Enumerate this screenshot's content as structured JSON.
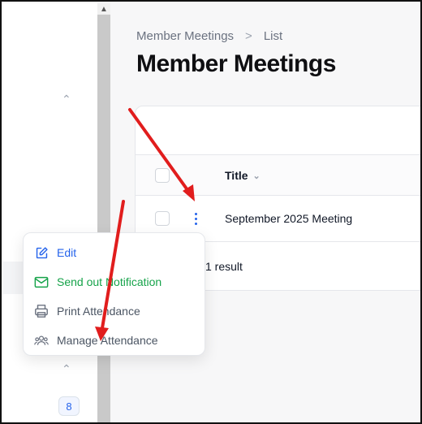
{
  "breadcrumb": {
    "parent": "Member Meetings",
    "separator": ">",
    "current": "List"
  },
  "page_title": "Member Meetings",
  "table": {
    "columns": [
      {
        "label": "Title",
        "sortable": true
      }
    ],
    "rows": [
      {
        "title": "September 2025 Meeting"
      }
    ],
    "result_count": "1 result"
  },
  "row_action_menu": {
    "items": [
      {
        "label": "Edit",
        "icon": "pencil-square-icon",
        "color": "#2563eb"
      },
      {
        "label": "Send out Notification",
        "icon": "envelope-icon",
        "color": "#16a34a"
      },
      {
        "label": "Print Attendance",
        "icon": "printer-icon",
        "color": "#4b5563"
      },
      {
        "label": "Manage Attendance",
        "icon": "user-group-icon",
        "color": "#4b5563"
      }
    ]
  },
  "sidebar": {
    "badge_count": "8"
  },
  "colors": {
    "accent": "#2563eb",
    "success": "#16a34a",
    "annotation_arrow": "#e11d1d"
  }
}
